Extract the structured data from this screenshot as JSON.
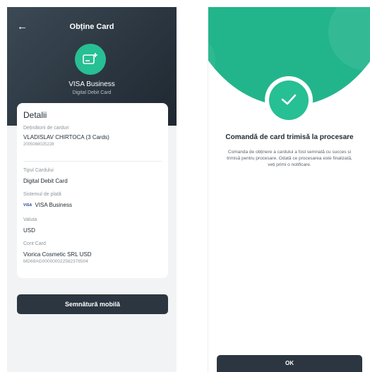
{
  "left_screen": {
    "header": {
      "back_icon": "arrow-left-icon",
      "title": "Obține Card",
      "card_icon": "card-add-icon",
      "card_type_name": "VISA Business",
      "card_type_sub": "Digital Debit Card"
    },
    "details": {
      "title": "Detalii",
      "holder_label": "Deținătorii de carduri",
      "holder_value": "VLADISLAV CHIRTOCA (3 Cards)",
      "holder_sub": "2005088025228",
      "card_type_label": "Tipul Cardului",
      "card_type_value": "Digital Debit Card",
      "payment_system_label": "Sistemul de plată",
      "payment_system_mark": "VISA",
      "payment_system_value": "VISA Business",
      "currency_label": "Valuta",
      "currency_value": "USD",
      "account_label": "Cont Card",
      "account_value": "Viorica Cosmetic SRL USD",
      "account_sub": "MD69AG000000022582376504"
    },
    "sign_button_label": "Semnătură mobilă"
  },
  "right_screen": {
    "check_icon": "checkmark-icon",
    "title": "Comandă de card trimisă la procesare",
    "message": "Comanda de obținere a cardului a fost semnată cu succes și trimisă pentru procesare. Odată ce procesarea este finalizată, veți primi o notificare.",
    "ok_button_label": "OK"
  },
  "colors": {
    "dark_header": "#2b3640",
    "accent_green": "#27bf94",
    "button_dark": "#2b3640",
    "visa_blue": "#1a3a8f"
  }
}
